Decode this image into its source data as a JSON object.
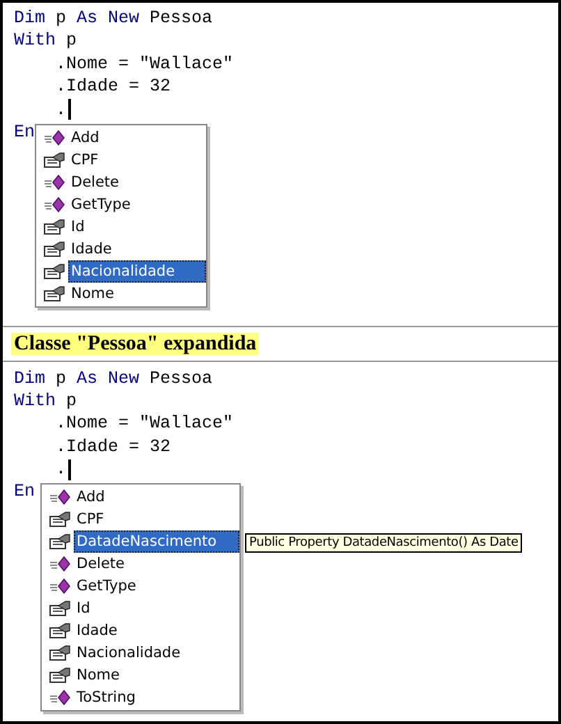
{
  "sections": [
    {
      "kind": "editor",
      "code": [
        {
          "tokens": [
            {
              "text": "Dim",
              "kind": "keyword"
            },
            {
              "text": " p ",
              "kind": "plain"
            },
            {
              "text": "As New",
              "kind": "keyword"
            },
            {
              "text": " Pessoa",
              "kind": "plain"
            }
          ],
          "caret": false
        },
        {
          "tokens": [
            {
              "text": "With",
              "kind": "keyword"
            },
            {
              "text": " p",
              "kind": "plain"
            }
          ],
          "caret": false
        },
        {
          "tokens": [
            {
              "text": "    .Nome = \"Wallace\"",
              "kind": "plain"
            }
          ],
          "caret": false
        },
        {
          "tokens": [
            {
              "text": "    .Idade = 32",
              "kind": "plain"
            }
          ],
          "caret": false
        },
        {
          "tokens": [
            {
              "text": "    .",
              "kind": "plain"
            }
          ],
          "caret": true
        },
        {
          "tokens": [
            {
              "text": "En",
              "kind": "keyword"
            }
          ],
          "caret": false
        }
      ],
      "list": [
        {
          "label": "Add",
          "kind": "method",
          "selected": false
        },
        {
          "label": "CPF",
          "kind": "property",
          "selected": false
        },
        {
          "label": "Delete",
          "kind": "method",
          "selected": false
        },
        {
          "label": "GetType",
          "kind": "method",
          "selected": false
        },
        {
          "label": "Id",
          "kind": "property",
          "selected": false
        },
        {
          "label": "Idade",
          "kind": "property",
          "selected": false
        },
        {
          "label": "Nacionalidade",
          "kind": "property",
          "selected": true
        },
        {
          "label": "Nome",
          "kind": "property",
          "selected": false
        }
      ]
    },
    {
      "kind": "caption",
      "text": "Classe \"Pessoa\" expandida"
    },
    {
      "kind": "editor",
      "code": [
        {
          "tokens": [
            {
              "text": "Dim",
              "kind": "keyword"
            },
            {
              "text": " p ",
              "kind": "plain"
            },
            {
              "text": "As New",
              "kind": "keyword"
            },
            {
              "text": " Pessoa",
              "kind": "plain"
            }
          ],
          "caret": false
        },
        {
          "tokens": [
            {
              "text": "With",
              "kind": "keyword"
            },
            {
              "text": " p",
              "kind": "plain"
            }
          ],
          "caret": false
        },
        {
          "tokens": [
            {
              "text": "    .Nome = \"Wallace\"",
              "kind": "plain"
            }
          ],
          "caret": false
        },
        {
          "tokens": [
            {
              "text": "    .Idade = 32",
              "kind": "plain"
            }
          ],
          "caret": false
        },
        {
          "tokens": [
            {
              "text": "    .",
              "kind": "plain"
            }
          ],
          "caret": true
        },
        {
          "tokens": [
            {
              "text": "En",
              "kind": "keyword"
            }
          ],
          "caret": false
        }
      ],
      "list": [
        {
          "label": "Add",
          "kind": "method",
          "selected": false
        },
        {
          "label": "CPF",
          "kind": "property",
          "selected": false
        },
        {
          "label": "DatadeNascimento",
          "kind": "property",
          "selected": true
        },
        {
          "label": "Delete",
          "kind": "method",
          "selected": false
        },
        {
          "label": "GetType",
          "kind": "method",
          "selected": false
        },
        {
          "label": "Id",
          "kind": "property",
          "selected": false
        },
        {
          "label": "Idade",
          "kind": "property",
          "selected": false
        },
        {
          "label": "Nacionalidade",
          "kind": "property",
          "selected": false
        },
        {
          "label": "Nome",
          "kind": "property",
          "selected": false
        },
        {
          "label": "ToString",
          "kind": "method",
          "selected": false
        }
      ],
      "tooltip": "Public Property DatadeNascimento() As Date"
    }
  ]
}
